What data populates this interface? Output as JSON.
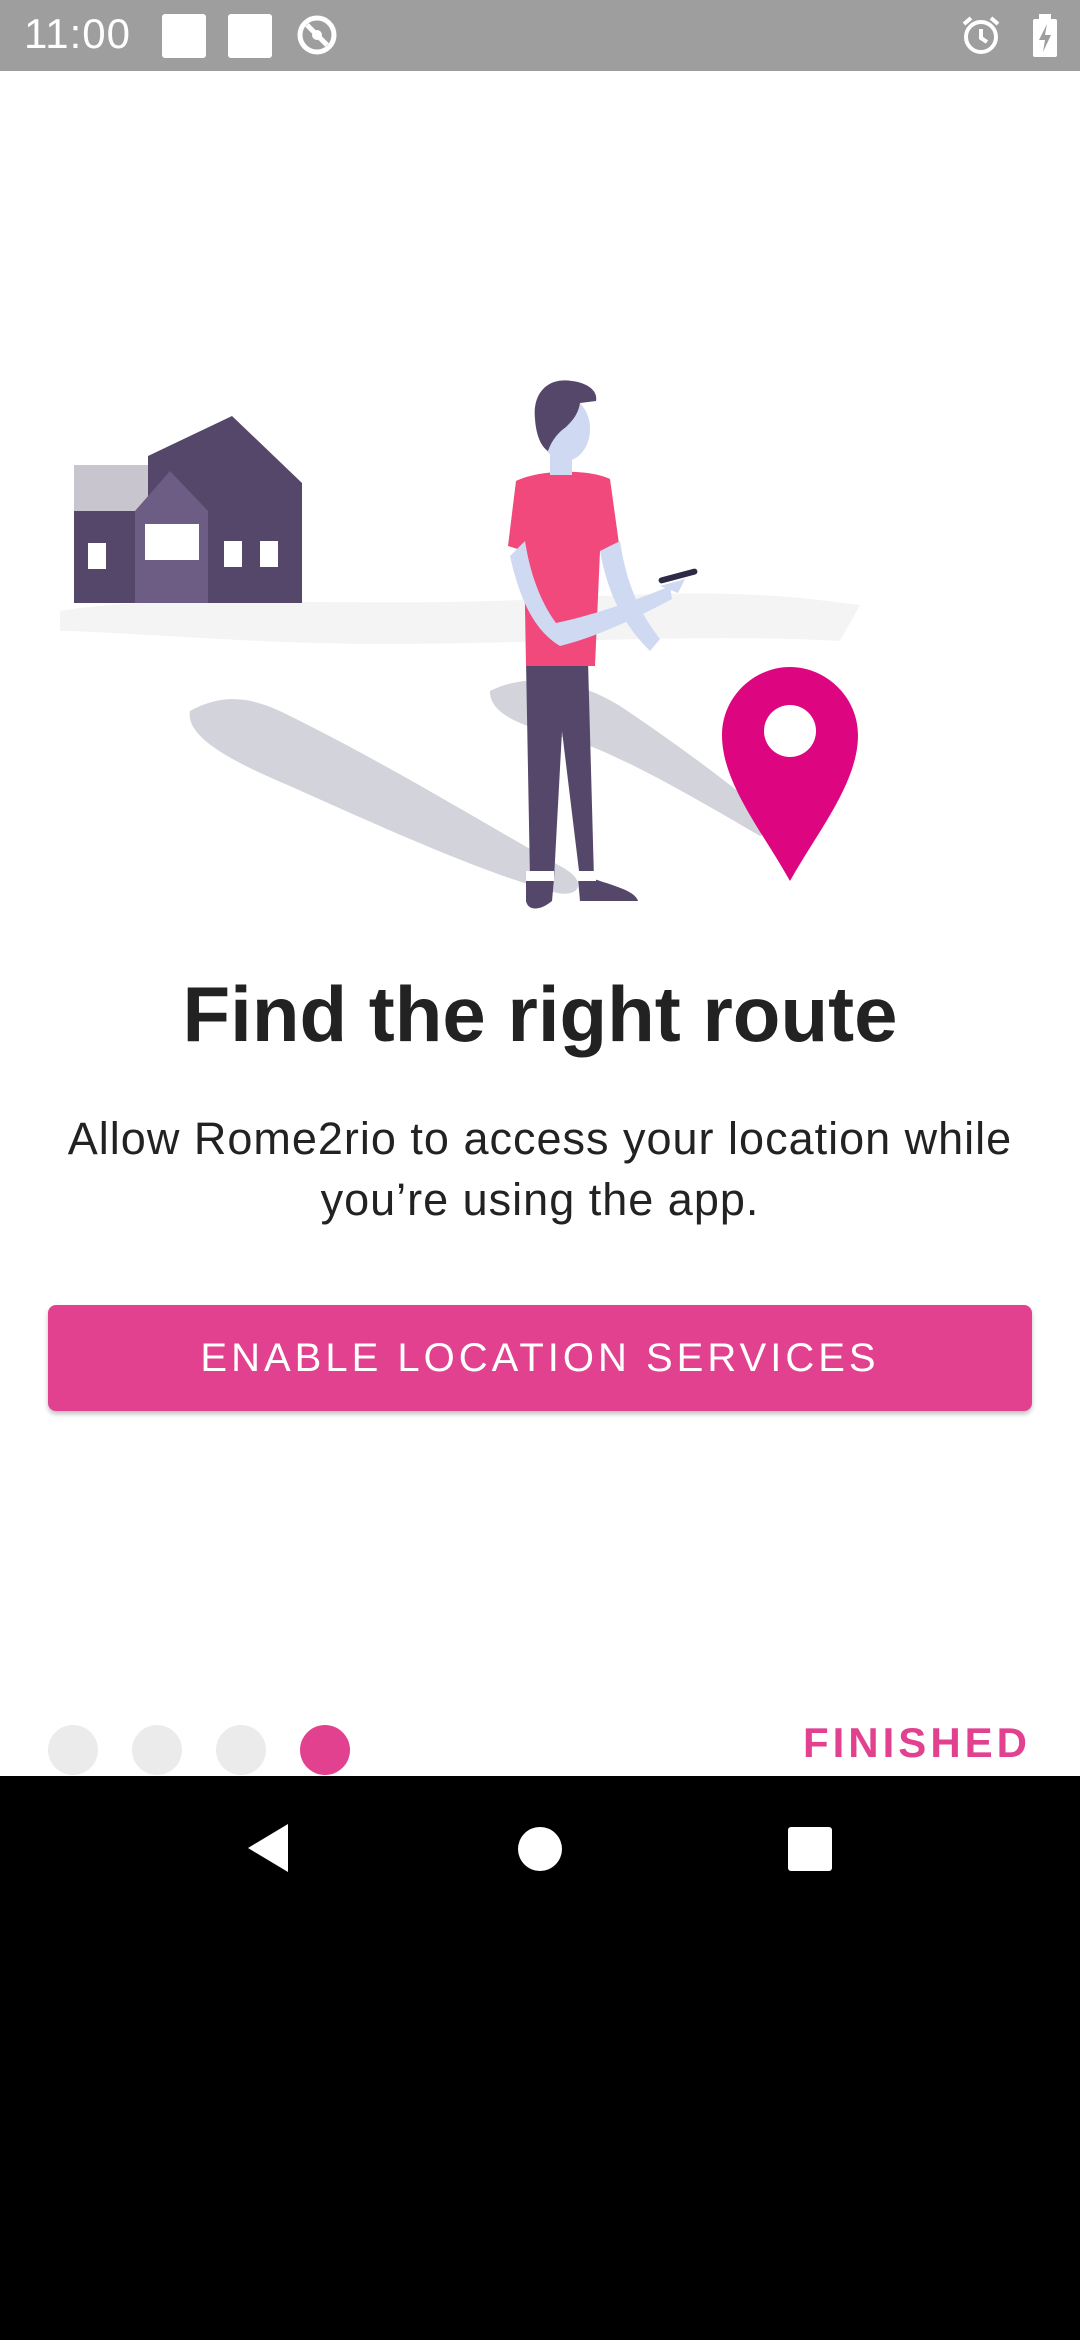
{
  "status_bar": {
    "time": "11:00",
    "icons": [
      "notification-square-icon",
      "notification-square-icon",
      "sync-disabled-icon",
      "alarm-icon",
      "battery-charging-icon"
    ]
  },
  "onboarding": {
    "title": "Find the right route",
    "description": "Allow Rome2rio to access your location while you’re using the app.",
    "enable_button_label": "ENABLE LOCATION SERVICES",
    "finished_label": "FINISHED",
    "page_count": 4,
    "current_page": 4
  },
  "colors": {
    "accent": "#e2418f",
    "pin": "#dd0680",
    "house": "#55476a",
    "status_bar": "#9e9e9e",
    "dot_inactive": "#ebebeb"
  },
  "nav_bar": {
    "icons": [
      "back-icon",
      "home-icon",
      "recents-icon"
    ]
  }
}
